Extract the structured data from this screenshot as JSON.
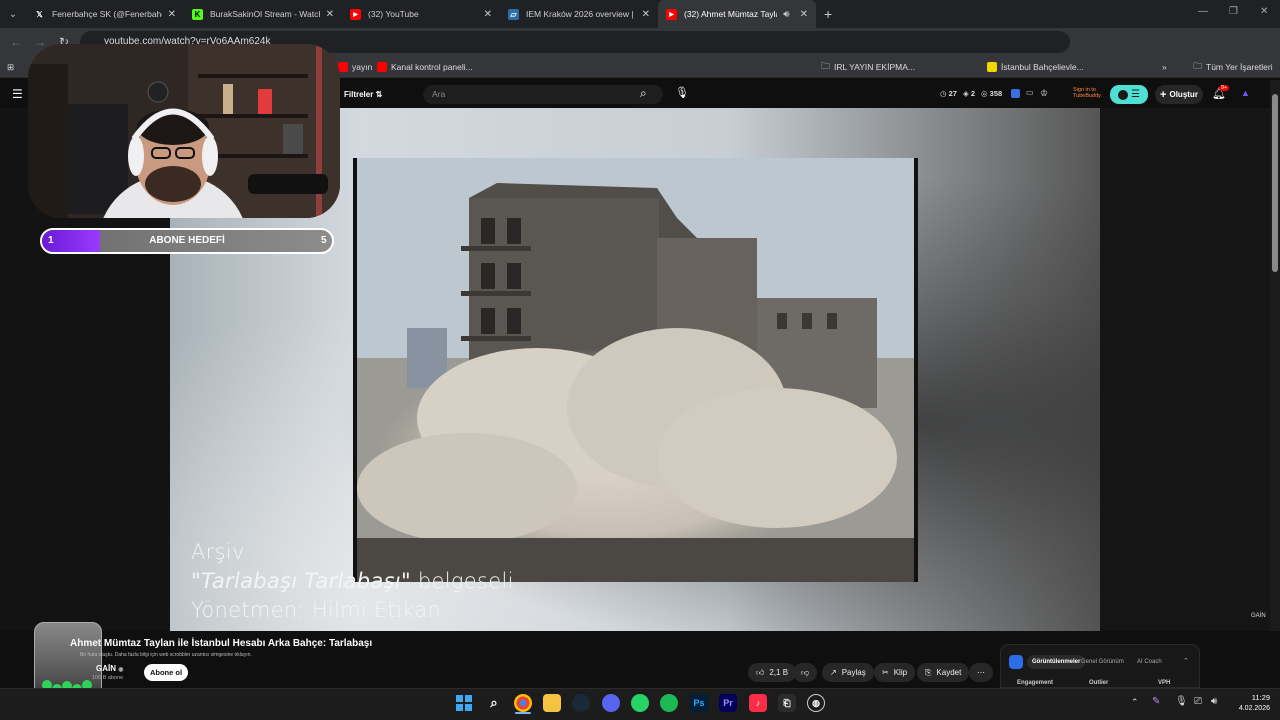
{
  "tabs": [
    {
      "title": "Fenerbahçe SK (@Fenerbahce)",
      "icon": "x-icon",
      "active": false
    },
    {
      "title": "BurakSakinOl Stream - Watch L",
      "icon": "kick-icon",
      "active": false
    },
    {
      "title": "(32) YouTube",
      "icon": "youtube-icon",
      "active": false
    },
    {
      "title": "IEM Kraków 2026 overview | HL",
      "icon": "hltv-icon",
      "active": false
    },
    {
      "title": "(32) Ahmet Mümtaz Taylan",
      "icon": "youtube-icon",
      "active": true
    }
  ],
  "address": {
    "url": "youtube.com/watch?v=rVo6AAm624k"
  },
  "bookmarks": {
    "items": [
      {
        "label": "yayın"
      },
      {
        "label": "Kanal kontrol paneli..."
      },
      {
        "label": "IRL YAYIN EKİPMA..."
      },
      {
        "label": "İstanbul Bahçelievle..."
      }
    ],
    "all_bookmarks": "Tüm Yer İşaretleri"
  },
  "youtube": {
    "filters_label": "Filtreler",
    "search_placeholder": "Ara",
    "stats": {
      "a": "27",
      "b": "2",
      "c": "358"
    },
    "sign_in": "Sign in to TubeBuddy",
    "create_label": "Oluştur",
    "notif_badge": "9+"
  },
  "overlay": {
    "goal_label": "ABONE HEDEFİ",
    "goal_current": "1",
    "goal_target": "5",
    "goal_fraction": 0.2
  },
  "video": {
    "caption_line1": "Arşiv",
    "caption_title": "\"Tarlabaşı Tarlabaşı\"",
    "caption_suffix": " belgeseli",
    "caption_line3": "Yönetmen: Hilmi Etikan",
    "watermark": "GAİN"
  },
  "info": {
    "title": "Ahmet Mümtaz Taylan ile İstanbul Hesabı Arka Bahçe: Tarlabaşı",
    "error_note": "Bir hata oluştu. Daha fazla bilgi için web scrobbler uzantısı simgesine tıklayın.",
    "channel": "GAİN",
    "subs": "106 B abone",
    "subscribe": "Abone ol",
    "likes": "2,1 B",
    "share": "Paylaş",
    "clip": "Klip",
    "save": "Kaydet"
  },
  "panel": {
    "tabs": [
      "Görüntülenmeler",
      "Genel Görünüm",
      "AI Coach"
    ],
    "cols": [
      "Engagement",
      "Outlier",
      "VPH"
    ]
  },
  "taskbar": {
    "time": "11:29",
    "date": "4.02.2026"
  }
}
